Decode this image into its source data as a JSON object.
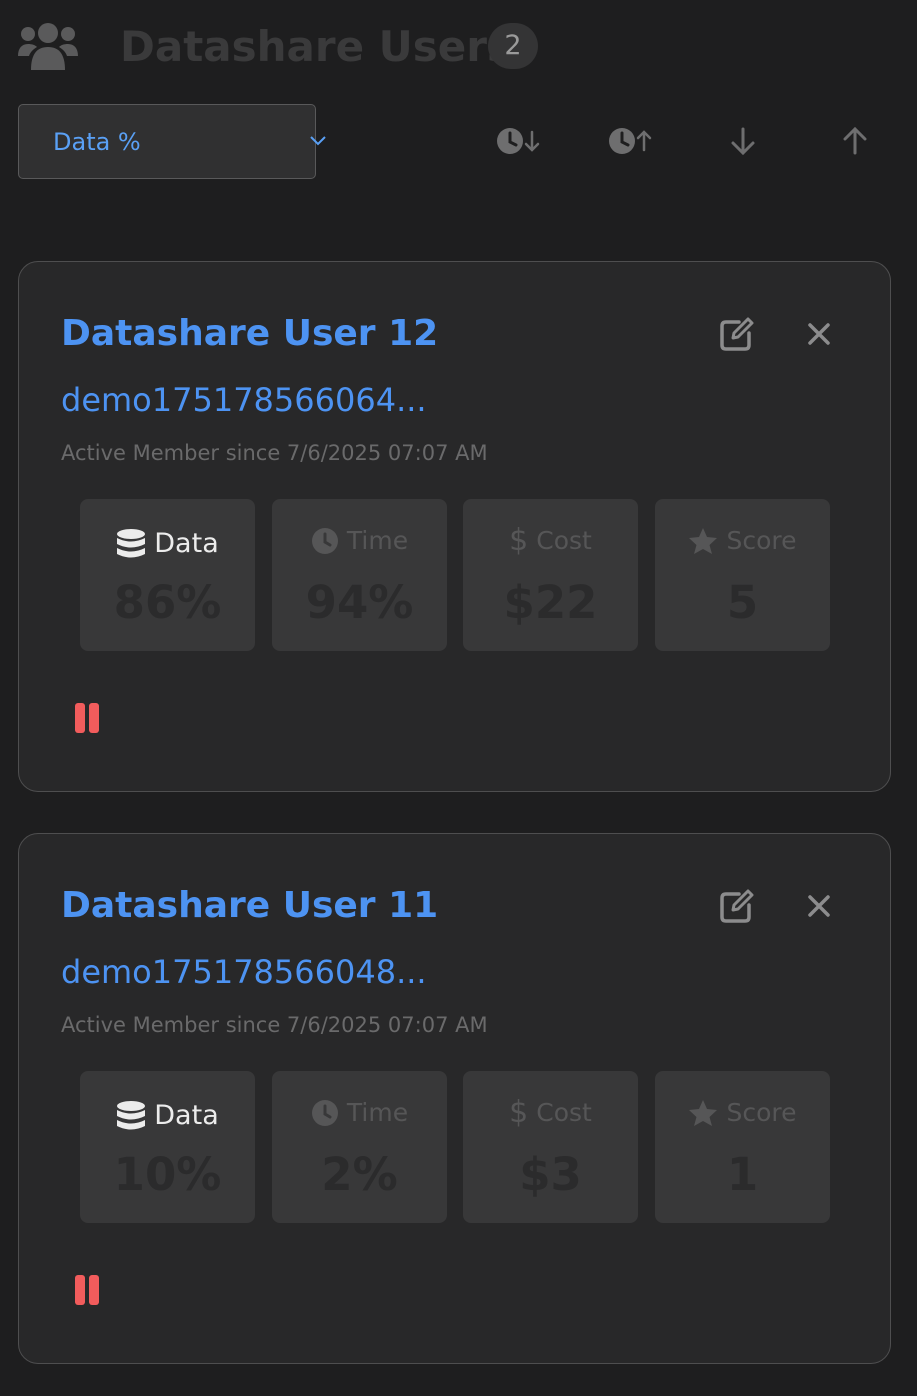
{
  "header": {
    "title": "Datashare Users",
    "count": "2",
    "icon": "users-icon"
  },
  "sort": {
    "selected": "Data %",
    "buttons": [
      "clock-sort-desc-icon",
      "clock-sort-asc-icon",
      "arrow-down-icon",
      "arrow-up-icon"
    ]
  },
  "colors": {
    "accent": "#4d93f2",
    "pause": "#f25c5c",
    "background": "#1e1e1f",
    "card": "#282829"
  },
  "users": [
    {
      "name": "Datashare User 12",
      "email": "demo175178566064...",
      "since": "Active Member since 7/6/2025 07:07 AM",
      "stats": [
        {
          "label": "Data",
          "value": "86%",
          "icon": "database-icon",
          "active": true
        },
        {
          "label": "Time",
          "value": "94%",
          "icon": "clock-icon",
          "active": false
        },
        {
          "label": "Cost",
          "value": "$22",
          "icon": "dollar-icon",
          "active": false
        },
        {
          "label": "Score",
          "value": "5",
          "icon": "star-icon",
          "active": false
        }
      ]
    },
    {
      "name": "Datashare User 11",
      "email": "demo175178566048...",
      "since": "Active Member since 7/6/2025 07:07 AM",
      "stats": [
        {
          "label": "Data",
          "value": "10%",
          "icon": "database-icon",
          "active": true
        },
        {
          "label": "Time",
          "value": "2%",
          "icon": "clock-icon",
          "active": false
        },
        {
          "label": "Cost",
          "value": "$3",
          "icon": "dollar-icon",
          "active": false
        },
        {
          "label": "Score",
          "value": "1",
          "icon": "star-icon",
          "active": false
        }
      ]
    }
  ]
}
